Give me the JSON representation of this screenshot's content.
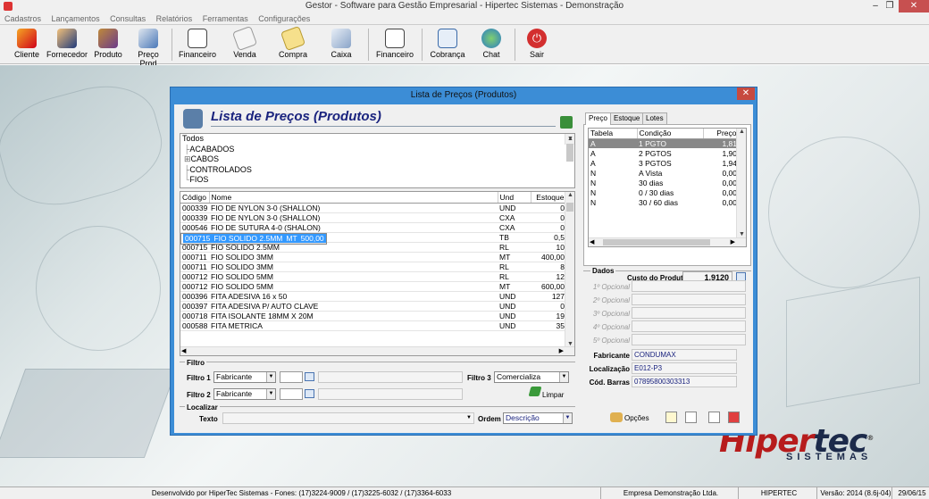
{
  "app": {
    "title": "Gestor - Software para Gestão Empresarial - Hipertec Sistemas - Demonstração"
  },
  "menu": [
    "Cadastros",
    "Lançamentos",
    "Consultas",
    "Relatórios",
    "Ferramentas",
    "Configurações"
  ],
  "toolbar": [
    {
      "label": "Cliente",
      "icon": "clients-icon"
    },
    {
      "label": "Fornecedor",
      "icon": "supplier-icon"
    },
    {
      "label": "Produto",
      "icon": "product-box-icon"
    },
    {
      "label": "Preço Prod",
      "icon": "price-icon"
    },
    {
      "label": "Financeiro",
      "icon": "ledger-icon"
    },
    {
      "label": "Venda",
      "icon": "sale-icon"
    },
    {
      "label": "Compra",
      "icon": "purchase-icon"
    },
    {
      "label": "Caixa",
      "icon": "cashier-icon"
    },
    {
      "label": "Financeiro",
      "icon": "finance-search-icon"
    },
    {
      "label": "Cobrança",
      "icon": "billing-icon"
    },
    {
      "label": "Chat",
      "icon": "chat-icon"
    },
    {
      "label": "Sair",
      "icon": "power-icon"
    }
  ],
  "window": {
    "title": "Lista de Preços (Produtos)",
    "header": "Lista de Preços (Produtos)"
  },
  "tree": {
    "root": "Todos",
    "items": [
      {
        "prefix": "├",
        "label": "ACABADOS"
      },
      {
        "prefix": "⊞",
        "label": "CABOS"
      },
      {
        "prefix": "├",
        "label": "CONTROLADOS"
      },
      {
        "prefix": "└",
        "label": "FIOS"
      }
    ]
  },
  "products": {
    "columns": [
      "Código",
      "Nome",
      "Und",
      "Estoque"
    ],
    "rows": [
      {
        "codigo": "000339",
        "nome": "FIO DE NYLON 3-0 (SHALLON)",
        "und": "UND",
        "estoque": "0",
        "selected": false
      },
      {
        "codigo": "000339",
        "nome": "FIO DE NYLON 3-0 (SHALLON)",
        "und": "CXA",
        "estoque": "0",
        "selected": false
      },
      {
        "codigo": "000546",
        "nome": "FIO DE SUTURA 4-0 (SHALON)",
        "und": "CXA",
        "estoque": "0",
        "selected": false
      },
      {
        "codigo": "000715",
        "nome": "FIO SOLIDO 2.5MM",
        "und": "MT",
        "estoque": "500,00",
        "selected": true
      },
      {
        "codigo": "000715",
        "nome": "FIO SOLIDO 2.5MM",
        "und": "TB",
        "estoque": "0,5",
        "selected": false
      },
      {
        "codigo": "000715",
        "nome": "FIO SOLIDO 2.5MM",
        "und": "RL",
        "estoque": "10",
        "selected": false
      },
      {
        "codigo": "000711",
        "nome": "FIO SOLIDO 3MM",
        "und": "MT",
        "estoque": "400,00",
        "selected": false
      },
      {
        "codigo": "000711",
        "nome": "FIO SOLIDO 3MM",
        "und": "RL",
        "estoque": "8",
        "selected": false
      },
      {
        "codigo": "000712",
        "nome": "FIO SOLIDO 5MM",
        "und": "RL",
        "estoque": "12",
        "selected": false
      },
      {
        "codigo": "000712",
        "nome": "FIO SOLIDO 5MM",
        "und": "MT",
        "estoque": "600,00",
        "selected": false
      },
      {
        "codigo": "000396",
        "nome": "FITA ADESIVA 16 x 50",
        "und": "UND",
        "estoque": "127",
        "selected": false
      },
      {
        "codigo": "000397",
        "nome": "FITA ADESIVA P/ AUTO CLAVE",
        "und": "UND",
        "estoque": "0",
        "selected": false
      },
      {
        "codigo": "000718",
        "nome": "FITA ISOLANTE 18MM X 20M",
        "und": "UND",
        "estoque": "19",
        "selected": false
      },
      {
        "codigo": "000588",
        "nome": "FITA METRICA",
        "und": "UND",
        "estoque": "35",
        "selected": false
      }
    ]
  },
  "filtro": {
    "section_label": "Filtro",
    "filtro1_label": "Filtro 1",
    "filtro1_value": "Fabricante",
    "filtro2_label": "Filtro 2",
    "filtro2_value": "Fabricante",
    "filtro3_label": "Filtro 3",
    "filtro3_value": "Comercializa",
    "limpar_label": "Limpar"
  },
  "localizar": {
    "section_label": "Localizar",
    "texto_label": "Texto",
    "texto_value": "",
    "ordem_label": "Ordem",
    "ordem_value": "Descrição"
  },
  "tabs": [
    "Preço",
    "Estoque",
    "Lotes"
  ],
  "precos": {
    "columns": [
      "Tabela",
      "Condição",
      "Preço"
    ],
    "rows": [
      {
        "tabela": "A",
        "condicao": "1 PGTO",
        "preco": "1,81",
        "highlight": true
      },
      {
        "tabela": "A",
        "condicao": "2 PGTOS",
        "preco": "1,90",
        "highlight": false
      },
      {
        "tabela": "A",
        "condicao": "3 PGTOS",
        "preco": "1,94",
        "highlight": false
      },
      {
        "tabela": "N",
        "condicao": "A Vista",
        "preco": "0,00",
        "highlight": false
      },
      {
        "tabela": "N",
        "condicao": "30 dias",
        "preco": "0,00",
        "highlight": false
      },
      {
        "tabela": "N",
        "condicao": "0 / 30 dias",
        "preco": "0,00",
        "highlight": false
      },
      {
        "tabela": "N",
        "condicao": "30 / 60 dias",
        "preco": "0,00",
        "highlight": false
      }
    ],
    "custo_label": "Custo do Produto",
    "custo_value": "1,9120"
  },
  "dados": {
    "section_label": "Dados",
    "opcionais": [
      "1º Opcional",
      "2º Opcional",
      "3º Opcional",
      "4º Opcional",
      "5º Opcional"
    ],
    "fabricante_label": "Fabricante",
    "fabricante_value": "CONDUMAX",
    "localizacao_label": "Localização",
    "localizacao_value": "E012-P3",
    "codbarras_label": "Cód. Barras",
    "codbarras_value": "07895800303313"
  },
  "buttons": {
    "opcoes_label": "Opções"
  },
  "branding": {
    "logo_main_a": "Hiper",
    "logo_main_b": "tec",
    "logo_sub": "SISTEMAS",
    "logo_reg": "®"
  },
  "statusbar": {
    "dev": "Desenvolvido por HiperTec Sistemas - Fones: (17)3224-9009 / (17)3225-6032 / (17)3364-6033",
    "empresa": "Empresa Demonstração Ltda.",
    "user": "HIPERTEC",
    "versao": "Versão: 2014 (8.6j-04)",
    "data": "29/06/15"
  },
  "colors": {
    "accent": "#3c8dd6",
    "selection": "#3399ff",
    "title_text": "#1a237e",
    "brand_red": "#b71c1c"
  }
}
